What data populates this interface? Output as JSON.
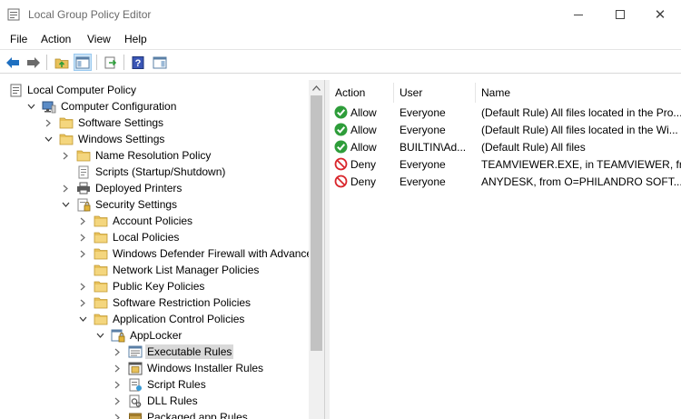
{
  "window": {
    "title": "Local Group Policy Editor",
    "minimize_icon": "minimize-icon",
    "maximize_icon": "maximize-icon",
    "close_icon": "close-icon"
  },
  "menu": [
    "File",
    "Action",
    "View",
    "Help"
  ],
  "toolbar": {
    "buttons": [
      "back-arrow-icon",
      "forward-arrow-icon",
      "up-folder-icon",
      "show-hide-tree-icon",
      "export-list-icon",
      "help-icon",
      "show-hide-action-pane-icon"
    ]
  },
  "tree": [
    {
      "label": "Local Computer Policy",
      "icon": "policy-icon",
      "level": 0,
      "expander": "none"
    },
    {
      "label": "Computer Configuration",
      "icon": "computer-icon",
      "level": 1,
      "expander": "expanded"
    },
    {
      "label": "Software Settings",
      "icon": "folder-icon",
      "level": 2,
      "expander": "collapsed"
    },
    {
      "label": "Windows Settings",
      "icon": "folder-icon",
      "level": 2,
      "expander": "expanded"
    },
    {
      "label": "Name Resolution Policy",
      "icon": "folder-icon",
      "level": 3,
      "expander": "collapsed"
    },
    {
      "label": "Scripts (Startup/Shutdown)",
      "icon": "script-icon",
      "level": 3,
      "expander": "none"
    },
    {
      "label": "Deployed Printers",
      "icon": "printer-icon",
      "level": 3,
      "expander": "collapsed"
    },
    {
      "label": "Security Settings",
      "icon": "security-icon",
      "level": 3,
      "expander": "expanded"
    },
    {
      "label": "Account Policies",
      "icon": "folder-icon",
      "level": 4,
      "expander": "collapsed"
    },
    {
      "label": "Local Policies",
      "icon": "folder-icon",
      "level": 4,
      "expander": "collapsed"
    },
    {
      "label": "Windows Defender Firewall with Advanced S",
      "icon": "folder-icon",
      "level": 4,
      "expander": "collapsed"
    },
    {
      "label": "Network List Manager Policies",
      "icon": "folder-icon",
      "level": 4,
      "expander": "none"
    },
    {
      "label": "Public Key Policies",
      "icon": "folder-icon",
      "level": 4,
      "expander": "collapsed"
    },
    {
      "label": "Software Restriction Policies",
      "icon": "folder-icon",
      "level": 4,
      "expander": "collapsed"
    },
    {
      "label": "Application Control Policies",
      "icon": "folder-icon",
      "level": 4,
      "expander": "expanded"
    },
    {
      "label": "AppLocker",
      "icon": "applocker-icon",
      "level": 5,
      "expander": "expanded"
    },
    {
      "label": "Executable Rules",
      "icon": "rule-list-icon",
      "level": 6,
      "expander": "collapsed",
      "selected": true
    },
    {
      "label": "Windows Installer Rules",
      "icon": "installer-icon",
      "level": 6,
      "expander": "collapsed"
    },
    {
      "label": "Script Rules",
      "icon": "script-rule-icon",
      "level": 6,
      "expander": "collapsed"
    },
    {
      "label": "DLL Rules",
      "icon": "dll-icon",
      "level": 6,
      "expander": "collapsed"
    },
    {
      "label": "Packaged app Rules",
      "icon": "package-icon",
      "level": 6,
      "expander": "collapsed"
    }
  ],
  "rules": {
    "columns": [
      "Action",
      "User",
      "Name"
    ],
    "rows": [
      {
        "action": "Allow",
        "user": "Everyone",
        "name": "(Default Rule) All files located in the Pro...",
        "icon": "allow-icon"
      },
      {
        "action": "Allow",
        "user": "Everyone",
        "name": "(Default Rule) All files located in the Wi...",
        "icon": "allow-icon"
      },
      {
        "action": "Allow",
        "user": "BUILTIN\\Ad...",
        "name": "(Default Rule) All files",
        "icon": "allow-icon"
      },
      {
        "action": "Deny",
        "user": "Everyone",
        "name": "TEAMVIEWER.EXE, in TEAMVIEWER, fro...",
        "icon": "deny-icon"
      },
      {
        "action": "Deny",
        "user": "Everyone",
        "name": "ANYDESK, from O=PHILANDRO SOFT...",
        "icon": "deny-icon"
      }
    ]
  },
  "colors": {
    "allow": "#2e9d3a",
    "deny": "#d9262c",
    "folder": "#e8c15a",
    "selection": "#d9d9d9",
    "accent": "#1e6fc0"
  }
}
